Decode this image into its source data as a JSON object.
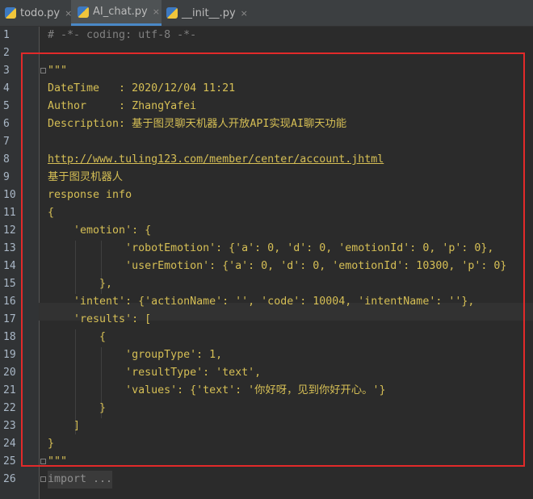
{
  "tabs": [
    {
      "label": "todo.py",
      "close": "×",
      "active": false
    },
    {
      "label": "AI_chat.py",
      "close": "×",
      "active": true
    },
    {
      "label": "__init__.py",
      "close": "×",
      "active": false
    }
  ],
  "editor": {
    "line_numbers": [
      "1",
      "2",
      "3",
      "4",
      "5",
      "6",
      "7",
      "8",
      "9",
      "10",
      "11",
      "12",
      "13",
      "14",
      "15",
      "16",
      "17",
      "18",
      "19",
      "20",
      "21",
      "22",
      "23",
      "24",
      "25",
      "26"
    ],
    "current_line": 17,
    "lines": [
      "# -*- coding: utf-8 -*-",
      "",
      "\"\"\"",
      "DateTime   : 2020/12/04 11:21",
      "Author     : ZhangYafei",
      "Description: 基于图灵聊天机器人开放API实现AI聊天功能",
      "",
      "http://www.tuling123.com/member/center/account.jhtml",
      "基于图灵机器人",
      "response info",
      "{",
      "    'emotion': {",
      "            'robotEmotion': {'a': 0, 'd': 0, 'emotionId': 0, 'p': 0},",
      "            'userEmotion': {'a': 0, 'd': 0, 'emotionId': 10300, 'p': 0}",
      "        },",
      "    'intent': {'actionName': '', 'code': 10004, 'intentName': ''},",
      "    'results': [",
      "        {",
      "            'groupType': 1,",
      "            'resultType': 'text',",
      "            'values': {'text': '你好呀，见到你好开心。'}",
      "        }",
      "    ]",
      "}",
      "\"\"\"",
      "import ..."
    ]
  },
  "colors": {
    "docstring": "#d6bf55",
    "comment": "#808080",
    "highlight_box": "#e22a2a",
    "line_number": "#a9b7c6"
  }
}
